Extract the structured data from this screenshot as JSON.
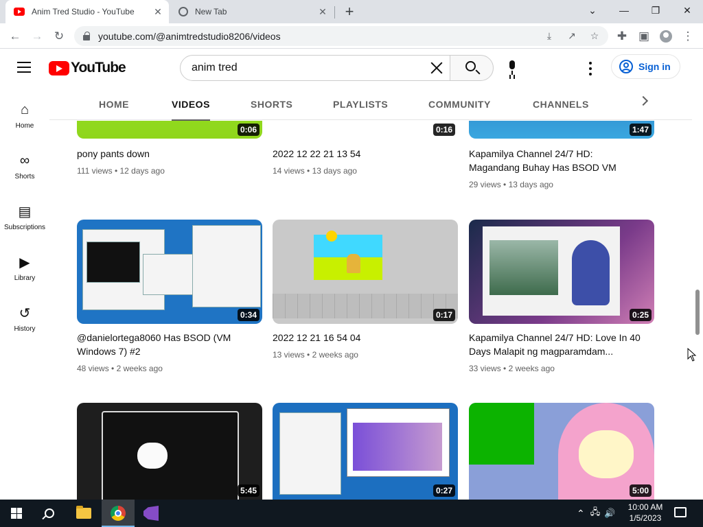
{
  "browser": {
    "tabs": [
      {
        "title": "Anim Tred Studio - YouTube",
        "active": true,
        "favicon": "youtube-icon"
      },
      {
        "title": "New Tab",
        "active": false,
        "favicon": "globe-icon"
      }
    ],
    "url": "youtube.com/@animtredstudio8206/videos"
  },
  "masthead": {
    "logo_text": "YouTube",
    "search_value": "anim tred",
    "signin_label": "Sign in"
  },
  "guide": {
    "items": [
      {
        "label": "Home",
        "icon": "home-icon"
      },
      {
        "label": "Shorts",
        "icon": "shorts-icon"
      },
      {
        "label": "Subscriptions",
        "icon": "subscriptions-icon"
      },
      {
        "label": "Library",
        "icon": "library-icon"
      },
      {
        "label": "History",
        "icon": "history-icon"
      }
    ]
  },
  "channel_tabs": {
    "items": [
      "HOME",
      "VIDEOS",
      "SHORTS",
      "PLAYLISTS",
      "COMMUNITY",
      "CHANNELS"
    ],
    "active": "VIDEOS"
  },
  "videos": [
    {
      "title": "pony pants down",
      "views": "111 views",
      "age": "12 days ago",
      "duration": "0:06"
    },
    {
      "title": "2022 12 22 21 13 54",
      "views": "14 views",
      "age": "13 days ago",
      "duration": "0:16"
    },
    {
      "title": "Kapamilya Channel 24/7 HD: Magandang Buhay Has BSOD VM",
      "views": "29 views",
      "age": "13 days ago",
      "duration": "1:47"
    },
    {
      "title": "@danielortega8060 Has BSOD (VM Windows 7) #2",
      "views": "48 views",
      "age": "2 weeks ago",
      "duration": "0:34"
    },
    {
      "title": "2022 12 21 16 54 04",
      "views": "13 views",
      "age": "2 weeks ago",
      "duration": "0:17"
    },
    {
      "title": "Kapamilya Channel 24/7 HD: Love In 40 Days Malapit ng magparamdam...",
      "views": "33 views",
      "age": "2 weeks ago",
      "duration": "0:25"
    },
    {
      "title": "",
      "views": "",
      "age": "",
      "duration": "5:45"
    },
    {
      "title": "",
      "views": "",
      "age": "",
      "duration": "0:27"
    },
    {
      "title": "",
      "views": "",
      "age": "",
      "duration": "5:00"
    }
  ],
  "meta_separator": "•",
  "taskbar": {
    "time": "10:00 AM",
    "date": "1/5/2023"
  },
  "colors": {
    "youtube_red": "#ff0000",
    "link_blue": "#065fd4",
    "taskbar_bg": "#101820"
  }
}
